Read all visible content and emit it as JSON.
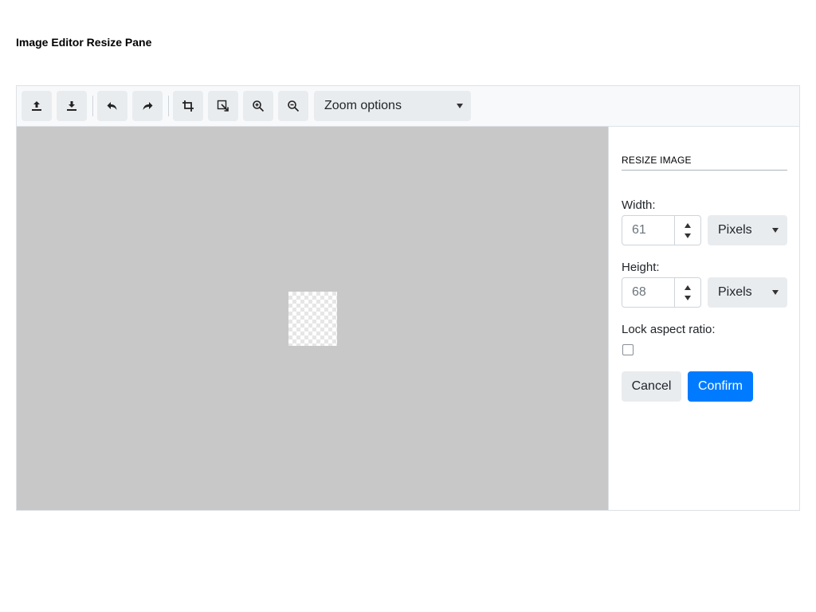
{
  "page": {
    "title": "Image Editor Resize Pane"
  },
  "toolbar": {
    "buttons": [
      {
        "icon": "upload-icon"
      },
      {
        "icon": "download-icon"
      },
      {
        "icon": "undo-icon"
      },
      {
        "icon": "redo-icon"
      },
      {
        "icon": "crop-icon"
      },
      {
        "icon": "resize-icon"
      },
      {
        "icon": "zoom-in-icon"
      },
      {
        "icon": "zoom-out-icon"
      }
    ],
    "zoom_select": {
      "label": "Zoom options"
    }
  },
  "canvas": {
    "background_color": "#c8c8c8"
  },
  "resize_pane": {
    "heading": "RESIZE IMAGE",
    "width": {
      "label": "Width:",
      "value": "61",
      "unit": "Pixels"
    },
    "height": {
      "label": "Height:",
      "value": "68",
      "unit": "Pixels"
    },
    "lock_aspect": {
      "label": "Lock aspect ratio:",
      "checked": false
    },
    "cancel_label": "Cancel",
    "confirm_label": "Confirm"
  },
  "colors": {
    "accent": "#007bff",
    "button_bg": "#e9ecef",
    "toolbar_bg": "#f8f9fa"
  }
}
